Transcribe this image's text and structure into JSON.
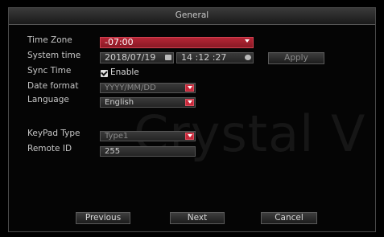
{
  "window": {
    "title": "General"
  },
  "watermark": "Crystal V",
  "labels": {
    "time_zone": "Time Zone",
    "system_time": "System time",
    "sync_time": "Sync Time",
    "date_format": "Date format",
    "language": "Language",
    "keypad_type": "KeyPad Type",
    "remote_id": "Remote ID"
  },
  "fields": {
    "time_zone": "-07:00",
    "date": "2018/07/19",
    "time": "14 :12 :27",
    "sync_enable": "Enable",
    "date_format": "YYYY/MM/DD",
    "language": "English",
    "keypad_type": "Type1",
    "remote_id": "255"
  },
  "buttons": {
    "apply": "Apply",
    "previous": "Previous",
    "next": "Next",
    "cancel": "Cancel"
  },
  "colors": {
    "accent": "#c8283a",
    "background": "#050505"
  }
}
